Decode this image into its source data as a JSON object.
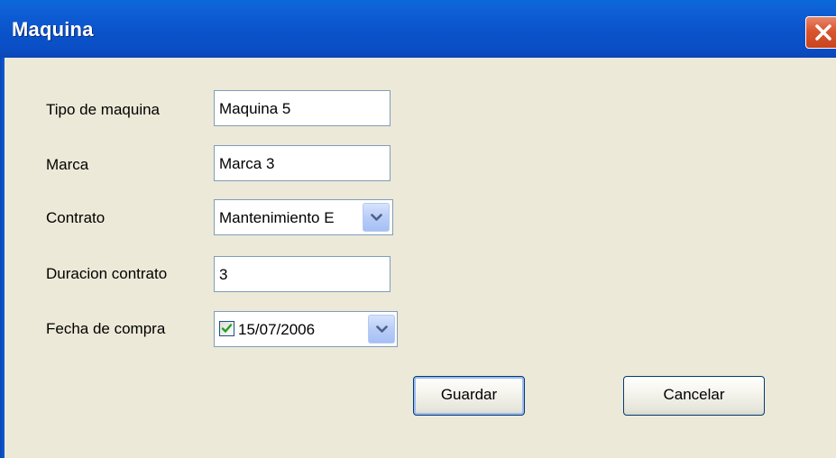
{
  "window": {
    "title": "Maquina"
  },
  "form": {
    "tipo_label": "Tipo de maquina",
    "tipo_value": "Maquina 5",
    "marca_label": "Marca",
    "marca_value": "Marca 3",
    "contrato_label": "Contrato",
    "contrato_value": "Mantenimiento E",
    "duracion_label": "Duracion contrato",
    "duracion_value": "3",
    "fecha_label": "Fecha de compra",
    "fecha_value": "15/07/2006",
    "fecha_checked": true
  },
  "buttons": {
    "save_label": "Guardar",
    "cancel_label": "Cancelar"
  },
  "colors": {
    "titlebar": "#0b54cc",
    "client_background": "#ece9d8",
    "close_button": "#d9552f",
    "input_border": "#7f9db9"
  },
  "icons": {
    "close": "close-icon",
    "dropdown": "chevron-down-icon",
    "check": "check-icon"
  }
}
